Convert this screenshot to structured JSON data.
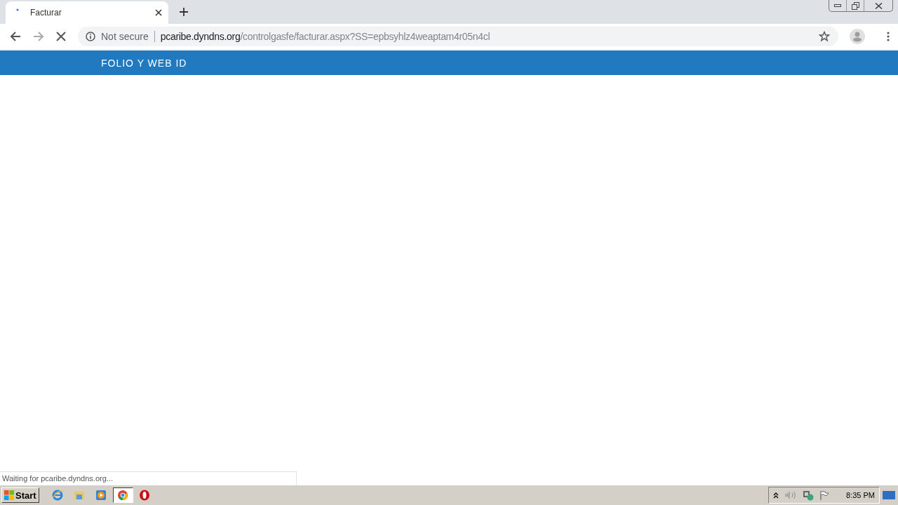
{
  "tab": {
    "title": "Facturar"
  },
  "address_bar": {
    "security": "Not secure",
    "host": "pcaribe.dyndns.org",
    "path": "/controlgasfe/facturar.aspx?SS=epbsyhlz4weaptam4r05n4cl"
  },
  "page": {
    "header": "FOLIO Y WEB ID"
  },
  "status_bubble": "Waiting for pcaribe.dyndns.org...",
  "taskbar": {
    "start": "Start",
    "apps": [
      {
        "kind": "ie",
        "selected": false
      },
      {
        "kind": "folder",
        "selected": false
      },
      {
        "kind": "media",
        "selected": false
      },
      {
        "kind": "chrome",
        "selected": true
      },
      {
        "kind": "opera",
        "selected": false
      }
    ],
    "clock": "8:35 PM"
  }
}
